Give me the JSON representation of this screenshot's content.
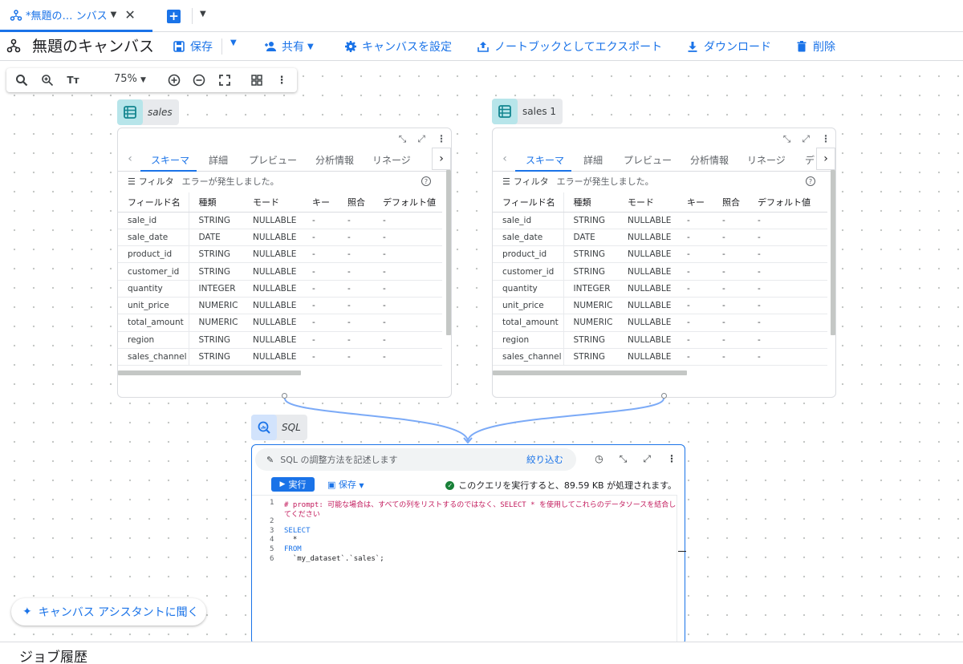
{
  "tab": {
    "label": "*無題の… ンバス"
  },
  "toolbar": {
    "title": "無題のキャンバス",
    "save": "保存",
    "share": "共有",
    "settings": "キャンバスを設定",
    "export": "ノートブックとしてエクスポート",
    "download": "ダウンロード",
    "delete": "削除"
  },
  "floatbar": {
    "zoom": "75%"
  },
  "nodes": {
    "left": {
      "label": "sales"
    },
    "right": {
      "label": "sales 1"
    },
    "sql": {
      "label": "SQL"
    }
  },
  "table_tabs": [
    "スキーマ",
    "詳細",
    "プレビュー",
    "分析情報",
    "リネージ"
  ],
  "right_extra_tab": "デ",
  "filter": {
    "label": "フィルタ",
    "error": "エラーが発生しました。"
  },
  "schema": {
    "columns": [
      "フィールド名",
      "種類",
      "モード",
      "キー",
      "照合",
      "デフォルト値"
    ],
    "rows": [
      [
        "sale_id",
        "STRING",
        "NULLABLE",
        "-",
        "-",
        "-"
      ],
      [
        "sale_date",
        "DATE",
        "NULLABLE",
        "-",
        "-",
        "-"
      ],
      [
        "product_id",
        "STRING",
        "NULLABLE",
        "-",
        "-",
        "-"
      ],
      [
        "customer_id",
        "STRING",
        "NULLABLE",
        "-",
        "-",
        "-"
      ],
      [
        "quantity",
        "INTEGER",
        "NULLABLE",
        "-",
        "-",
        "-"
      ],
      [
        "unit_price",
        "NUMERIC",
        "NULLABLE",
        "-",
        "-",
        "-"
      ],
      [
        "total_amount",
        "NUMERIC",
        "NULLABLE",
        "-",
        "-",
        "-"
      ],
      [
        "region",
        "STRING",
        "NULLABLE",
        "-",
        "-",
        "-"
      ],
      [
        "sales_channel",
        "STRING",
        "NULLABLE",
        "-",
        "-",
        "-"
      ]
    ]
  },
  "sql": {
    "prompt_placeholder": "SQL の調整方法を記述します",
    "refine": "絞り込む",
    "run": "実行",
    "save": "保存",
    "query_info": "このクエリを実行すると、89.59 KB が処理されます。",
    "lines": [
      {
        "n": "1",
        "text": "# prompt: 可能な場合は、すべての列をリストするのではなく、SELECT * を使用してこれらのデータソースを結合し",
        "cls": "cm"
      },
      {
        "n": "",
        "text": "てください",
        "cls": "cm"
      },
      {
        "n": "2",
        "text": "",
        "cls": "tx"
      },
      {
        "n": "3",
        "text": "SELECT",
        "cls": "kw"
      },
      {
        "n": "4",
        "text": "  *",
        "cls": "tx"
      },
      {
        "n": "5",
        "text": "FROM",
        "cls": "kw"
      },
      {
        "n": "6",
        "text": "  `my_dataset`.`sales`;",
        "cls": "tx"
      }
    ]
  },
  "assistant": {
    "label": "キャンバス アシスタントに聞く"
  },
  "jobs": {
    "label": "ジョブ履歴"
  },
  "colors": {
    "accent": "#1a73e8",
    "table_badge": "#b7e5ea",
    "sql_badge": "#d2e3fc",
    "connector": "#7baaf7"
  }
}
